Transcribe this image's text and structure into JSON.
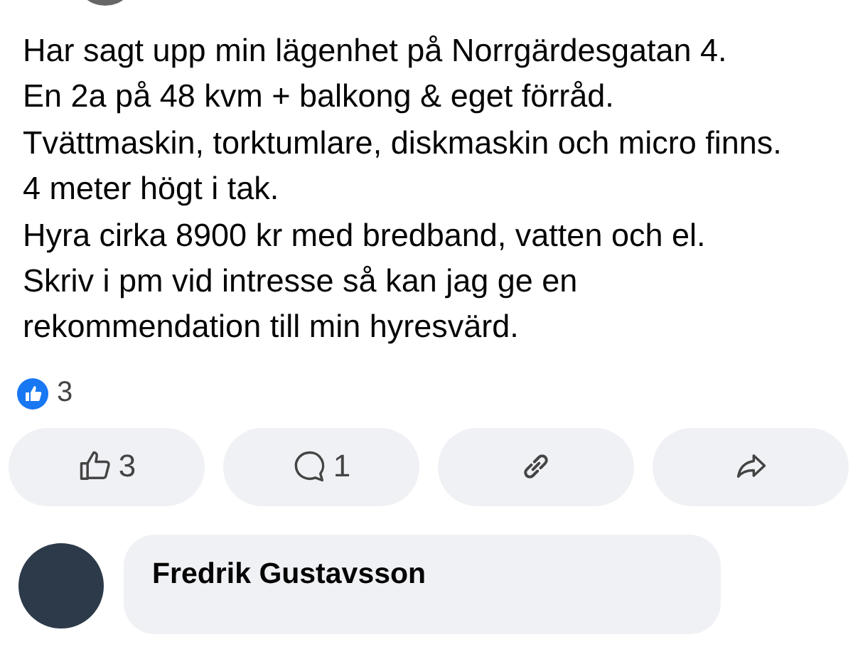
{
  "post": {
    "text": "Har sagt upp min lägenhet på Norrgärdesgatan 4.\nEn 2a på 48 kvm + balkong & eget förråd.\nTvättmaskin, torktumlare, diskmaskin och micro finns.\n4 meter högt i tak.\nHyra cirka 8900 kr med bredband, vatten och el.\nSkriv i pm vid intresse så kan jag ge en rekommendation till min hyresvärd."
  },
  "reactions": {
    "count": "3"
  },
  "actions": [
    {
      "kind": "like",
      "count": "3"
    },
    {
      "kind": "comment",
      "count": "1"
    },
    {
      "kind": "link"
    },
    {
      "kind": "share"
    }
  ],
  "comment": {
    "author": "Fredrik Gustavsson"
  }
}
